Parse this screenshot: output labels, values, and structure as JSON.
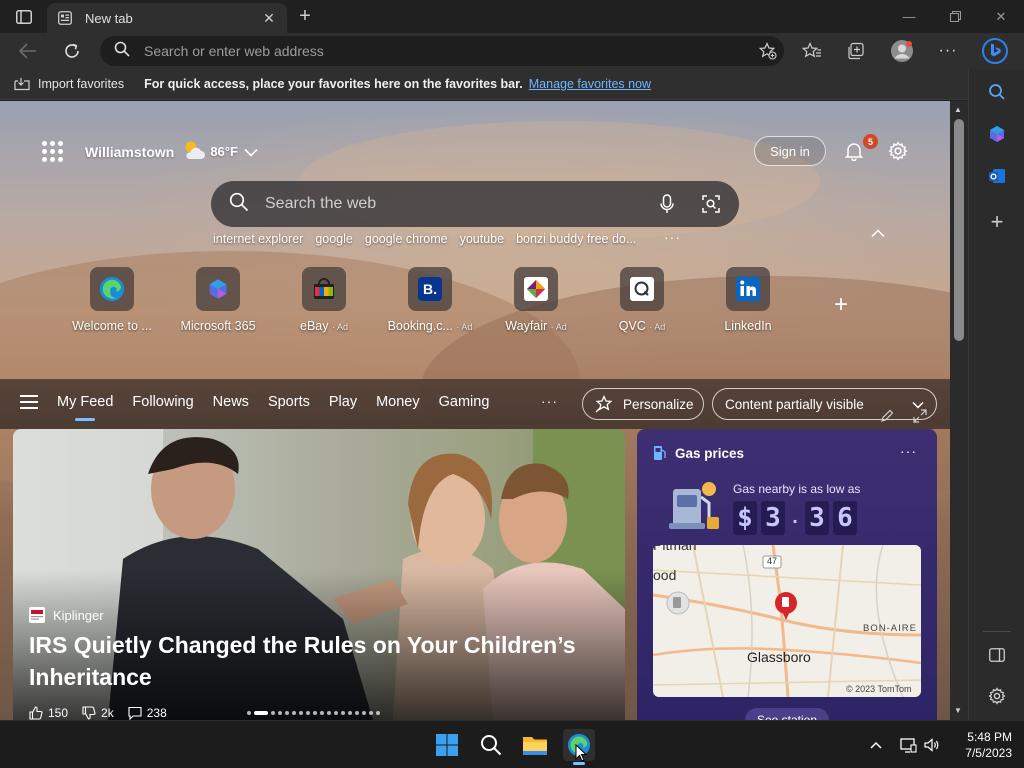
{
  "tab": {
    "title": "New tab"
  },
  "address": {
    "placeholder": "Search or enter web address"
  },
  "favorites_bar": {
    "import_label": "Import favorites",
    "message": "For quick access, place your favorites here on the favorites bar.",
    "link": "Manage favorites now"
  },
  "ntp": {
    "city": "Williamstown",
    "temperature": "86°F",
    "sign_in": "Sign in",
    "notification_count": "5",
    "search_placeholder": "Search the web",
    "trending": [
      "internet explorer",
      "google",
      "google chrome",
      "youtube",
      "bonzi buddy free do..."
    ],
    "quick_links": [
      {
        "label": "Welcome to ...",
        "ad": "",
        "icon": "edge-icon"
      },
      {
        "label": "Microsoft 365",
        "ad": "",
        "icon": "m365-icon"
      },
      {
        "label": "eBay",
        "ad": "· Ad",
        "icon": "ebay-icon"
      },
      {
        "label": "Booking.c...",
        "ad": "· Ad",
        "icon": "booking-icon"
      },
      {
        "label": "Wayfair",
        "ad": "· Ad",
        "icon": "wayfair-icon"
      },
      {
        "label": "QVC",
        "ad": "· Ad",
        "icon": "qvc-icon"
      },
      {
        "label": "LinkedIn",
        "ad": "",
        "icon": "linkedin-icon"
      }
    ]
  },
  "feed": {
    "tabs": [
      "My Feed",
      "Following",
      "News",
      "Sports",
      "Play",
      "Money",
      "Gaming"
    ],
    "personalize": "Personalize",
    "visibility": "Content partially visible"
  },
  "hero": {
    "source": "Kiplinger",
    "headline": "IRS Quietly Changed the Rules on Your Children’s Inheritance",
    "likes": "150",
    "dislikes": "2k",
    "comments": "238"
  },
  "gas": {
    "title": "Gas prices",
    "subtitle": "Gas nearby is as low as",
    "price_symbol": "$",
    "price_digits": [
      "3",
      "3",
      "6"
    ],
    "map_labels": {
      "top": "Pitman",
      "left": "ood",
      "route": "47",
      "east": "BON-AIRE",
      "town": "Glassboro",
      "credit": "© 2023 TomTom"
    },
    "see_station": "See station"
  },
  "taskbar": {
    "time": "5:48 PM",
    "date": "7/5/2023"
  },
  "colors": {
    "accent": "#7cc0ff",
    "link": "#6fb5ff",
    "badge": "#d24726",
    "gas_card": "#3d2f72"
  }
}
